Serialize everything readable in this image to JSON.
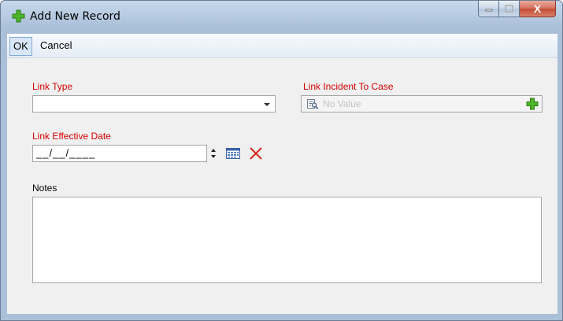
{
  "window": {
    "title": "Add New Record",
    "close_glyph": "X",
    "icons": {
      "title": "plus-icon",
      "minimize": "minimize-icon",
      "maximize": "maximize-icon",
      "close": "close-icon"
    }
  },
  "toolbar": {
    "ok_label": "OK",
    "cancel_label": "Cancel"
  },
  "form": {
    "link_type": {
      "label": "Link Type",
      "value": ""
    },
    "link_incident": {
      "label": "Link Incident To Case",
      "placeholder": "No Value"
    },
    "link_effective_date": {
      "label": "Link Effective Date",
      "value": "__/__/____"
    },
    "notes": {
      "label": "Notes",
      "value": ""
    }
  },
  "colors": {
    "required_label": "#d40000",
    "add_icon_green": "#3da01f",
    "clear_icon_red": "#d42b1e"
  }
}
